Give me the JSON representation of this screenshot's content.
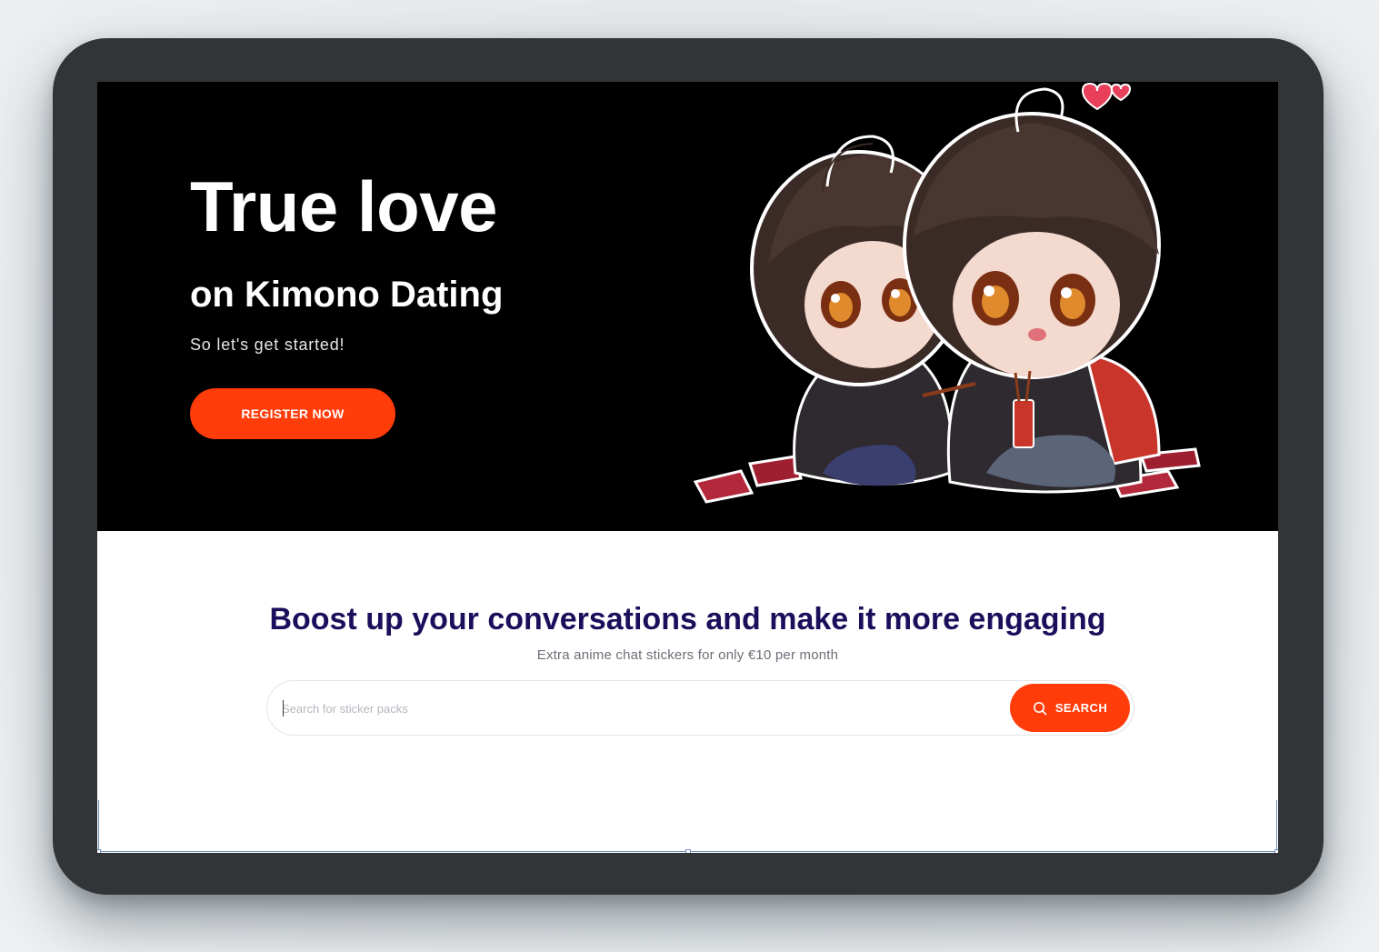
{
  "hero": {
    "title": "True love",
    "subtitle": "on Kimono Dating",
    "tagline": "So let's get started!",
    "cta_label": "REGISTER NOW",
    "illustration": "anime-couple-illustration"
  },
  "stickers": {
    "title": "Boost up your conversations and make it more engaging",
    "subtitle": "Extra anime chat stickers for only €10 per month",
    "search": {
      "placeholder": "Search for sticker packs",
      "value": "",
      "button_label": "SEARCH",
      "button_icon": "search-icon"
    }
  },
  "colors": {
    "accent": "#ff3c0a",
    "heading": "#1b0f5c",
    "hero_bg": "#000000",
    "device_frame": "#323538"
  }
}
